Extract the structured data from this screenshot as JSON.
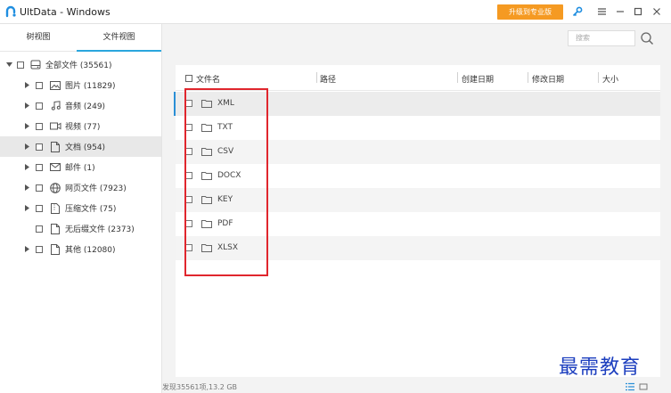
{
  "window": {
    "title": "UltData - Windows",
    "upgrade_label": "升级到专业版",
    "accent": "#f59a22"
  },
  "tabs": [
    {
      "label": "树视图"
    },
    {
      "label": "文件视图"
    }
  ],
  "tree": {
    "root": {
      "label": "全部文件 (35561)",
      "icon": "drive-icon"
    },
    "items": [
      {
        "label": "图片 (11829)",
        "icon": "image-icon"
      },
      {
        "label": "音频 (249)",
        "icon": "music-icon"
      },
      {
        "label": "视频 (77)",
        "icon": "video-icon"
      },
      {
        "label": "文档 (954)",
        "icon": "document-icon"
      },
      {
        "label": "邮件 (1)",
        "icon": "mail-icon"
      },
      {
        "label": "网页文件 (7923)",
        "icon": "globe-icon"
      },
      {
        "label": "压缩文件 (75)",
        "icon": "archive-icon"
      },
      {
        "label": "无后缀文件 (2373)",
        "icon": "file-icon"
      },
      {
        "label": "其他 (12080)",
        "icon": "file-icon"
      }
    ]
  },
  "search": {
    "placeholder": "搜索"
  },
  "columns": {
    "name": "文件名",
    "path": "路径",
    "created": "创建日期",
    "modified": "修改日期",
    "size": "大小"
  },
  "files": [
    {
      "name": "XML"
    },
    {
      "name": "TXT"
    },
    {
      "name": "CSV"
    },
    {
      "name": "DOCX"
    },
    {
      "name": "KEY"
    },
    {
      "name": "PDF"
    },
    {
      "name": "XLSX"
    }
  ],
  "status": {
    "text": "发现35561项,13.2 GB"
  },
  "watermark": "最需教育"
}
